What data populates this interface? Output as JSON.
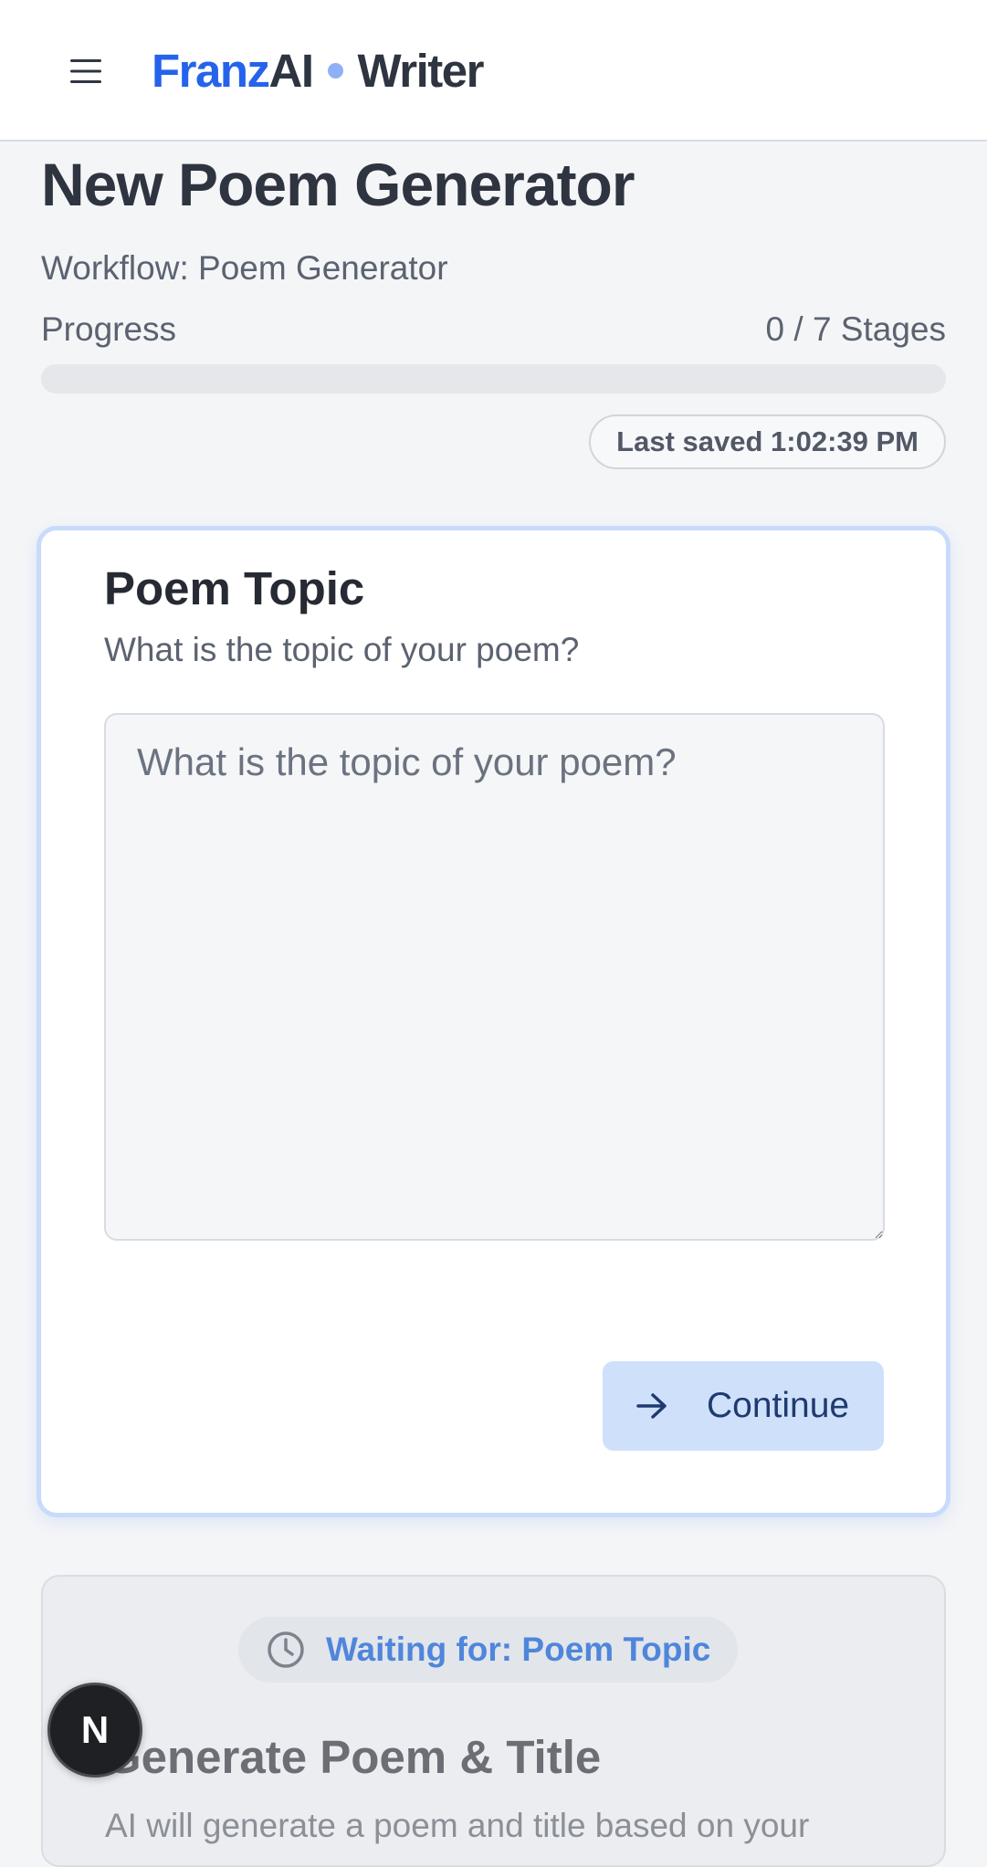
{
  "header": {
    "menu_icon": "hamburger-menu-icon",
    "brand": {
      "franz": "Franz",
      "ai": "AI",
      "writer": "Writer"
    },
    "colors": {
      "brand_blue": "#2563eb",
      "brand_dot": "#8fb0f5"
    }
  },
  "page": {
    "title": "New Poem Generator",
    "workflow": "Workflow: Poem Generator",
    "progress": {
      "label": "Progress",
      "count": "0 / 7 Stages",
      "completed": 0,
      "total": 7
    },
    "last_saved": "Last saved 1:02:39 PM"
  },
  "stage_active": {
    "title": "Poem Topic",
    "description": "What is the topic of your poem?",
    "input": {
      "placeholder": "What is the topic of your poem?",
      "value": ""
    },
    "continue_label": "Continue",
    "continue_icon": "arrow-right-icon"
  },
  "stage_waiting": {
    "badge": "Waiting for: Poem Topic",
    "badge_icon": "clock-icon",
    "title": "Generate Poem & Title",
    "description": "AI will generate a poem and title based on your"
  },
  "dev_badge": {
    "letter": "N",
    "icon": "nextjs-dev-indicator-icon"
  }
}
